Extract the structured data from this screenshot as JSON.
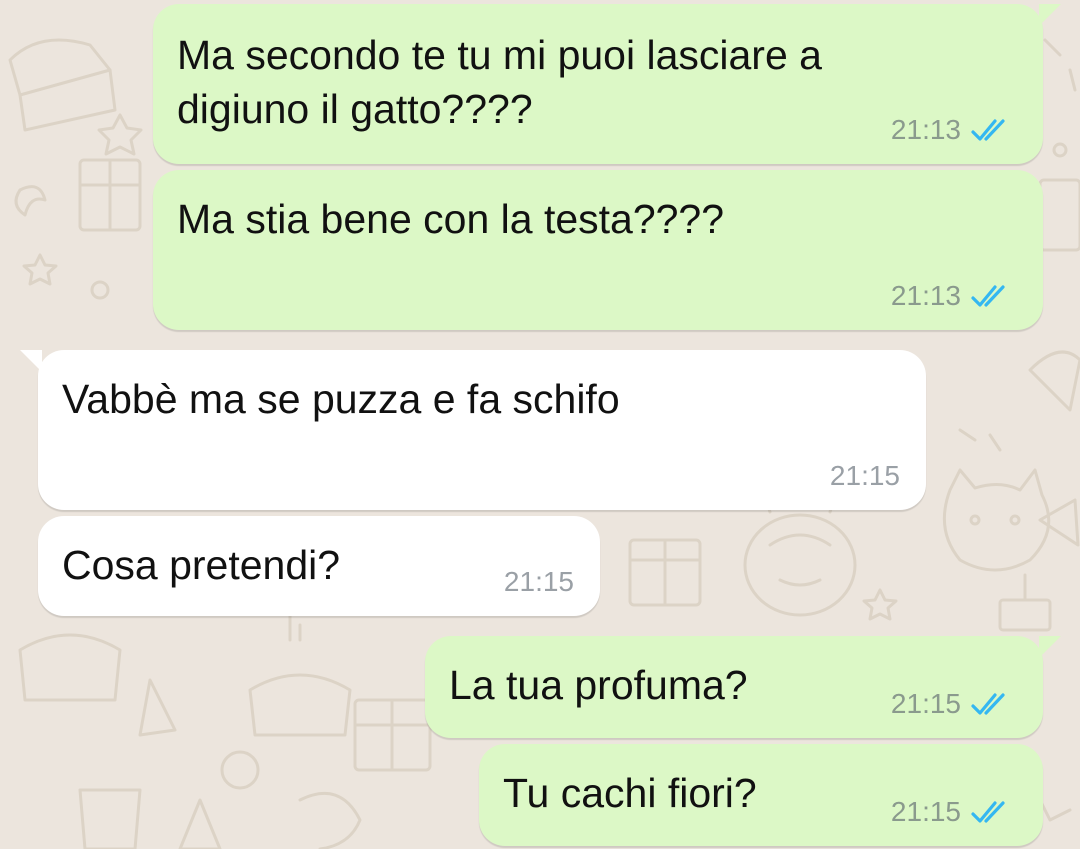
{
  "colors": {
    "background": "#ECE5DD",
    "outgoing_bubble": "#DCF8C6",
    "incoming_bubble": "#FFFFFF",
    "read_ticks": "#34B7F1"
  },
  "messages": [
    {
      "direction": "outgoing",
      "text": "Ma secondo te tu mi puoi lasciare a\ndigiuno il gatto????",
      "time": "21:13",
      "status_icon": "double-check-read-icon"
    },
    {
      "direction": "outgoing",
      "text": "Ma stia bene con la testa????",
      "time": "21:13",
      "status_icon": "double-check-read-icon"
    },
    {
      "direction": "incoming",
      "text": "Vabbè ma se puzza e fa schifo",
      "time": "21:15"
    },
    {
      "direction": "incoming",
      "text": "Cosa pretendi?",
      "time": "21:15"
    },
    {
      "direction": "outgoing",
      "text": "La tua profuma?",
      "time": "21:15",
      "status_icon": "double-check-read-icon"
    },
    {
      "direction": "outgoing",
      "text": "Tu cachi fiori?",
      "time": "21:15",
      "status_icon": "double-check-read-icon"
    }
  ]
}
